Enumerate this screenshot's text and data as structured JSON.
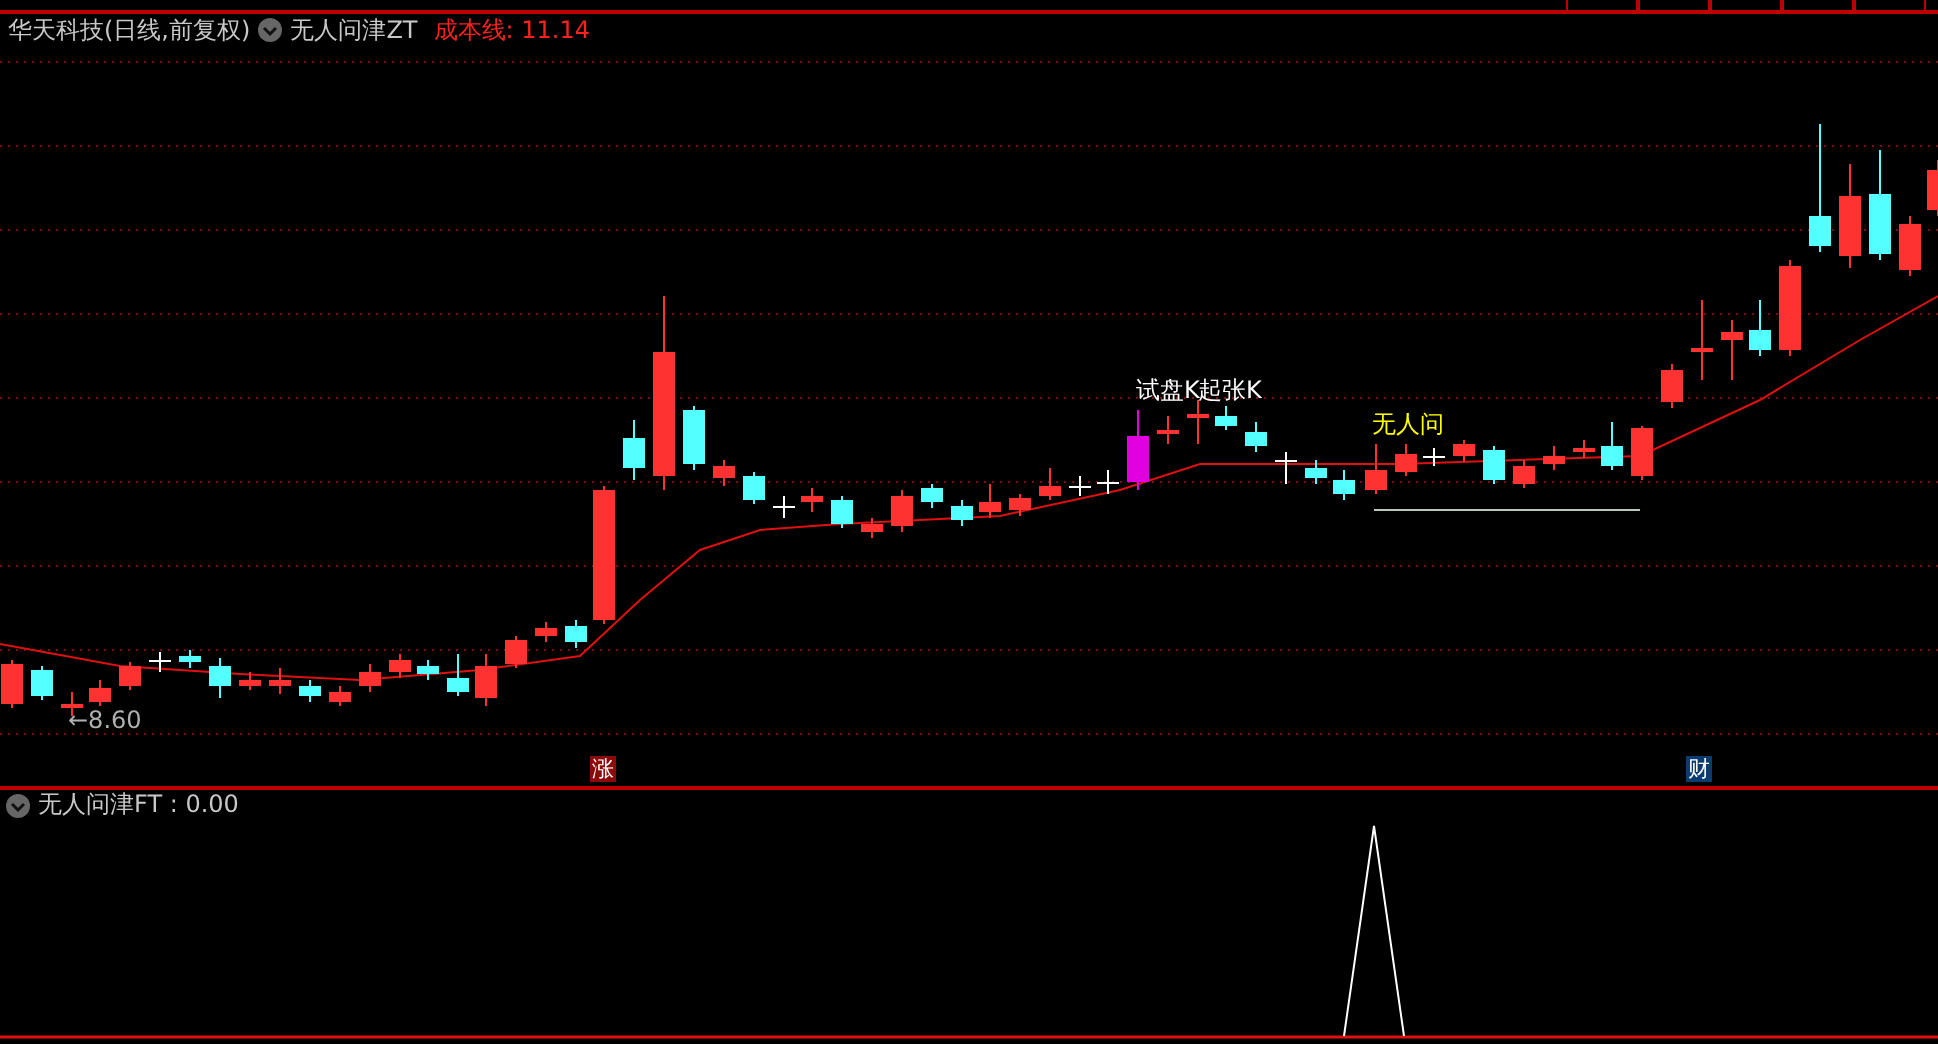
{
  "header": {
    "title": "华天科技(日线,前复权)",
    "indicator": "无人问津ZT",
    "cost_line": "成本线: 11.14"
  },
  "chart": {
    "annotations": [
      {
        "text": "试盘K",
        "color": "#ffffff"
      },
      {
        "text": "起张K",
        "color": "#ffffff"
      },
      {
        "text": "无人问",
        "color": "#ffff00"
      }
    ],
    "low_marker": "←8.60",
    "badges": [
      {
        "text": "涨",
        "color": "#8b0a0a"
      },
      {
        "text": "财",
        "color": "#0b3c70"
      }
    ]
  },
  "sub_panel": {
    "label": "无人问津FT : 0.00"
  }
}
